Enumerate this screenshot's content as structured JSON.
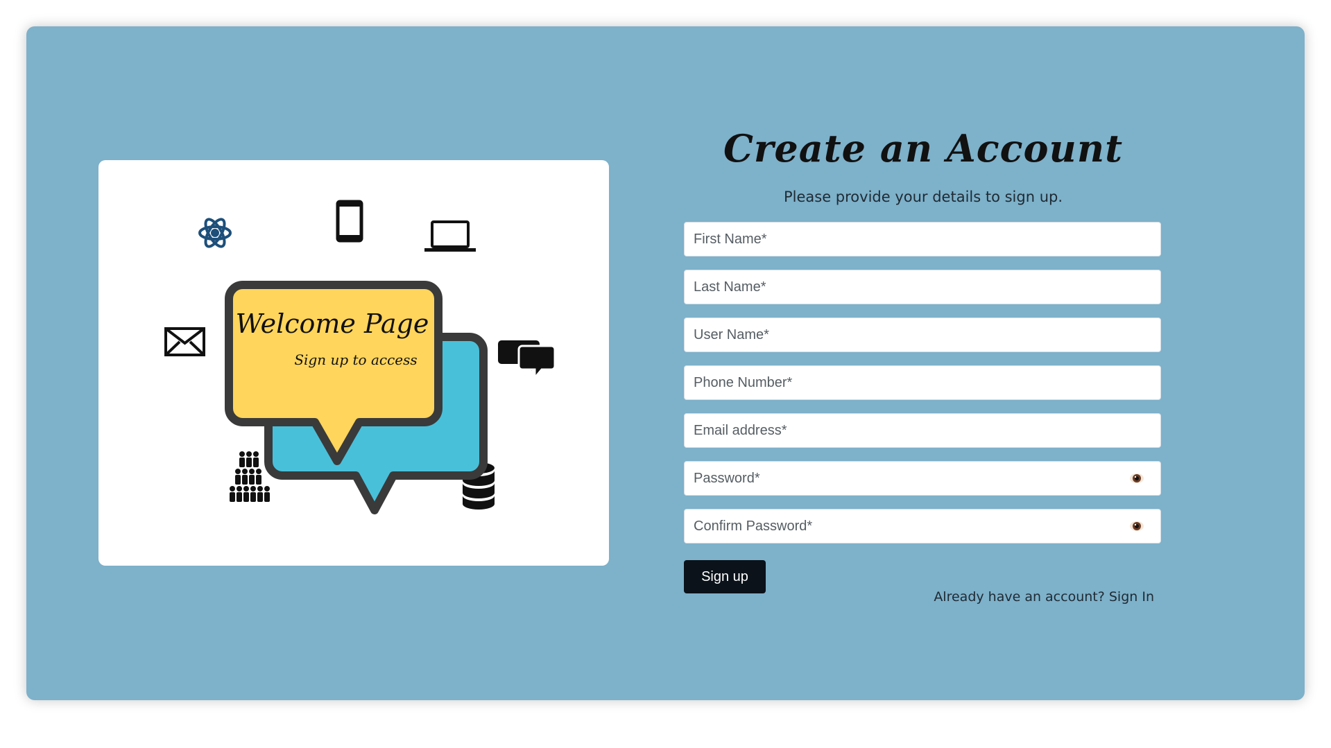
{
  "brand_color": "#7eb1ca",
  "illustration": {
    "heading": "Welcome Page",
    "subheading": "Sign up to access",
    "icons": [
      "atom-icon",
      "smartphone-icon",
      "laptop-icon",
      "envelope-icon",
      "chat-bubbles-icon",
      "people-group-icon",
      "database-icon"
    ],
    "colors": {
      "front_bubble": "#ffd55c",
      "back_bubble": "#49c0da",
      "outline": "#3a3a3a"
    }
  },
  "form": {
    "title": "Create an Account",
    "subtitle": "Please provide your details to sign up.",
    "fields": {
      "first_name": {
        "placeholder": "First Name*",
        "value": ""
      },
      "last_name": {
        "placeholder": "Last Name*",
        "value": ""
      },
      "user_name": {
        "placeholder": "User Name*",
        "value": ""
      },
      "phone": {
        "placeholder": "Phone Number*",
        "value": ""
      },
      "email": {
        "placeholder": "Email address*",
        "value": ""
      },
      "password": {
        "placeholder": "Password*",
        "value": ""
      },
      "confirm_password": {
        "placeholder": "Confirm Password*",
        "value": ""
      }
    },
    "submit_label": "Sign up",
    "signin_prompt": "Already have an account? Sign In"
  }
}
